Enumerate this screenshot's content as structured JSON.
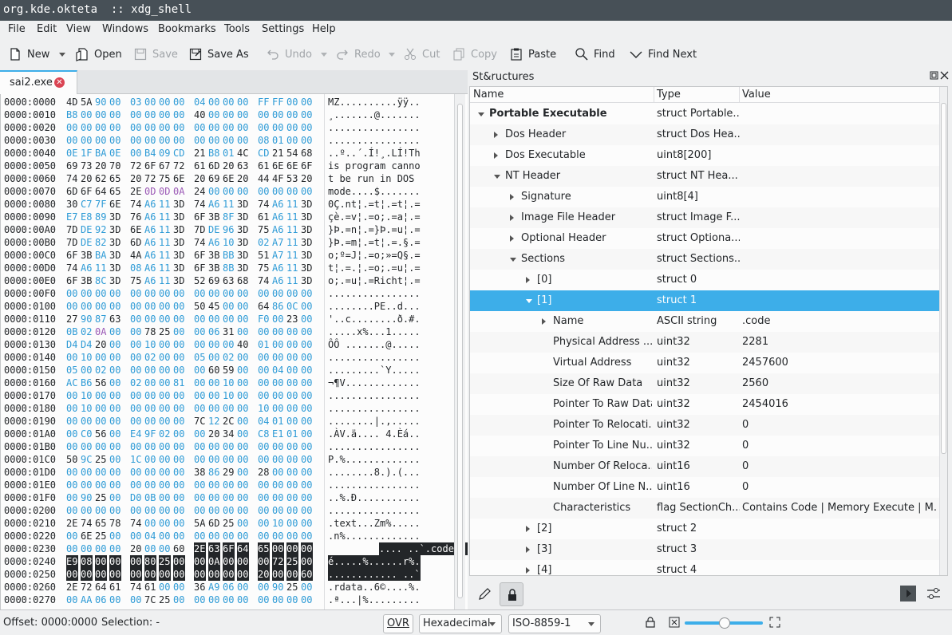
{
  "window": {
    "title": "org.kde.okteta  :: xdg_shell"
  },
  "menu": [
    "File",
    "Edit",
    "View",
    "Windows",
    "Bookmarks",
    "Tools",
    "Settings",
    "Help"
  ],
  "toolbar": {
    "new": "New",
    "open": "Open",
    "save": "Save",
    "save_as": "Save As",
    "undo": "Undo",
    "redo": "Redo",
    "cut": "Cut",
    "copy": "Copy",
    "paste": "Paste",
    "find": "Find",
    "find_next": "Find Next"
  },
  "tab": {
    "label": "sai2.exe"
  },
  "hex_rows": [
    {
      "off": "0000:0000",
      "bytes": [
        "4D",
        "5A",
        "90",
        "00",
        "03",
        "00",
        "00",
        "00",
        "04",
        "00",
        "00",
        "00",
        "FF",
        "FF",
        "00",
        "00"
      ],
      "chars": "MZ..........ÿÿ.."
    },
    {
      "off": "0000:0010",
      "bytes": [
        "B8",
        "00",
        "00",
        "00",
        "00",
        "00",
        "00",
        "00",
        "40",
        "00",
        "00",
        "00",
        "00",
        "00",
        "00",
        "00"
      ],
      "chars": "¸.......@......."
    },
    {
      "off": "0000:0020",
      "bytes": [
        "00",
        "00",
        "00",
        "00",
        "00",
        "00",
        "00",
        "00",
        "00",
        "00",
        "00",
        "00",
        "00",
        "00",
        "00",
        "00"
      ],
      "chars": "................"
    },
    {
      "off": "0000:0030",
      "bytes": [
        "00",
        "00",
        "00",
        "00",
        "00",
        "00",
        "00",
        "00",
        "00",
        "00",
        "00",
        "00",
        "08",
        "01",
        "00",
        "00"
      ],
      "chars": "................"
    },
    {
      "off": "0000:0040",
      "bytes": [
        "0E",
        "1F",
        "BA",
        "0E",
        "00",
        "B4",
        "09",
        "CD",
        "21",
        "B8",
        "01",
        "4C",
        "CD",
        "21",
        "54",
        "68"
      ],
      "chars": "..º..´.Í!¸.LÍ!Th"
    },
    {
      "off": "0000:0050",
      "bytes": [
        "69",
        "73",
        "20",
        "70",
        "72",
        "6F",
        "67",
        "72",
        "61",
        "6D",
        "20",
        "63",
        "61",
        "6E",
        "6E",
        "6F"
      ],
      "chars": "is program canno"
    },
    {
      "off": "0000:0060",
      "bytes": [
        "74",
        "20",
        "62",
        "65",
        "20",
        "72",
        "75",
        "6E",
        "20",
        "69",
        "6E",
        "20",
        "44",
        "4F",
        "53",
        "20"
      ],
      "chars": "t be run in DOS "
    },
    {
      "off": "0000:0070",
      "bytes": [
        "6D",
        "6F",
        "64",
        "65",
        "2E",
        "0D",
        "0D",
        "0A",
        "24",
        "00",
        "00",
        "00",
        "00",
        "00",
        "00",
        "00"
      ],
      "chars": "mode....$......."
    },
    {
      "off": "0000:0080",
      "bytes": [
        "30",
        "C7",
        "7F",
        "6E",
        "74",
        "A6",
        "11",
        "3D",
        "74",
        "A6",
        "11",
        "3D",
        "74",
        "A6",
        "11",
        "3D"
      ],
      "chars": "0Ç.nt¦.=t¦.=t¦.="
    },
    {
      "off": "0000:0090",
      "bytes": [
        "E7",
        "E8",
        "89",
        "3D",
        "76",
        "A6",
        "11",
        "3D",
        "6F",
        "3B",
        "8F",
        "3D",
        "61",
        "A6",
        "11",
        "3D"
      ],
      "chars": "çè.=v¦.=o;.=a¦.="
    },
    {
      "off": "0000:00A0",
      "bytes": [
        "7D",
        "DE",
        "92",
        "3D",
        "6E",
        "A6",
        "11",
        "3D",
        "7D",
        "DE",
        "96",
        "3D",
        "75",
        "A6",
        "11",
        "3D"
      ],
      "chars": "}Þ.=n¦.=}Þ.=u¦.="
    },
    {
      "off": "0000:00B0",
      "bytes": [
        "7D",
        "DE",
        "82",
        "3D",
        "6D",
        "A6",
        "11",
        "3D",
        "74",
        "A6",
        "10",
        "3D",
        "02",
        "A7",
        "11",
        "3D"
      ],
      "chars": "}Þ.=m¦.=t¦.=.§.="
    },
    {
      "off": "0000:00C0",
      "bytes": [
        "6F",
        "3B",
        "BA",
        "3D",
        "4A",
        "A6",
        "11",
        "3D",
        "6F",
        "3B",
        "BB",
        "3D",
        "51",
        "A7",
        "11",
        "3D"
      ],
      "chars": "o;º=J¦.=o;»=Q§.="
    },
    {
      "off": "0000:00D0",
      "bytes": [
        "74",
        "A6",
        "11",
        "3D",
        "08",
        "A6",
        "11",
        "3D",
        "6F",
        "3B",
        "8B",
        "3D",
        "75",
        "A6",
        "11",
        "3D"
      ],
      "chars": "t¦.=.¦.=o;.=u¦.="
    },
    {
      "off": "0000:00E0",
      "bytes": [
        "6F",
        "3B",
        "8C",
        "3D",
        "75",
        "A6",
        "11",
        "3D",
        "52",
        "69",
        "63",
        "68",
        "74",
        "A6",
        "11",
        "3D"
      ],
      "chars": "o;.=u¦.=Richt¦.="
    },
    {
      "off": "0000:00F0",
      "bytes": [
        "00",
        "00",
        "00",
        "00",
        "00",
        "00",
        "00",
        "00",
        "00",
        "00",
        "00",
        "00",
        "00",
        "00",
        "00",
        "00"
      ],
      "chars": "................"
    },
    {
      "off": "0000:0100",
      "bytes": [
        "00",
        "00",
        "00",
        "00",
        "00",
        "00",
        "00",
        "00",
        "50",
        "45",
        "00",
        "00",
        "64",
        "86",
        "0C",
        "00"
      ],
      "chars": "........PE..d..."
    },
    {
      "off": "0000:0110",
      "bytes": [
        "27",
        "90",
        "87",
        "63",
        "00",
        "00",
        "00",
        "00",
        "00",
        "00",
        "00",
        "00",
        "F0",
        "00",
        "23",
        "00"
      ],
      "chars": "'..c........ð.#."
    },
    {
      "off": "0000:0120",
      "bytes": [
        "0B",
        "02",
        "0A",
        "00",
        "00",
        "78",
        "25",
        "00",
        "00",
        "06",
        "31",
        "00",
        "00",
        "00",
        "00",
        "00"
      ],
      "chars": ".....x%...1....."
    },
    {
      "off": "0000:0130",
      "bytes": [
        "D4",
        "D4",
        "20",
        "00",
        "00",
        "10",
        "00",
        "00",
        "00",
        "00",
        "00",
        "40",
        "01",
        "00",
        "00",
        "00"
      ],
      "chars": "ÔÔ .......@....."
    },
    {
      "off": "0000:0140",
      "bytes": [
        "00",
        "10",
        "00",
        "00",
        "00",
        "02",
        "00",
        "00",
        "05",
        "00",
        "02",
        "00",
        "00",
        "00",
        "00",
        "00"
      ],
      "chars": "................"
    },
    {
      "off": "0000:0150",
      "bytes": [
        "05",
        "00",
        "02",
        "00",
        "00",
        "00",
        "00",
        "00",
        "00",
        "60",
        "59",
        "00",
        "00",
        "04",
        "00",
        "00"
      ],
      "chars": ".........`Y....."
    },
    {
      "off": "0000:0160",
      "bytes": [
        "AC",
        "B6",
        "56",
        "00",
        "02",
        "00",
        "00",
        "81",
        "00",
        "00",
        "10",
        "00",
        "00",
        "00",
        "00",
        "00"
      ],
      "chars": "¬¶V............."
    },
    {
      "off": "0000:0170",
      "bytes": [
        "00",
        "10",
        "00",
        "00",
        "00",
        "00",
        "00",
        "00",
        "00",
        "00",
        "10",
        "00",
        "00",
        "00",
        "00",
        "00"
      ],
      "chars": "................"
    },
    {
      "off": "0000:0180",
      "bytes": [
        "00",
        "10",
        "00",
        "00",
        "00",
        "00",
        "00",
        "00",
        "00",
        "00",
        "00",
        "00",
        "10",
        "00",
        "00",
        "00"
      ],
      "chars": "................"
    },
    {
      "off": "0000:0190",
      "bytes": [
        "00",
        "00",
        "00",
        "00",
        "00",
        "00",
        "00",
        "00",
        "7C",
        "12",
        "2C",
        "00",
        "04",
        "01",
        "00",
        "00"
      ],
      "chars": "........|.,....."
    },
    {
      "off": "0000:01A0",
      "bytes": [
        "00",
        "C0",
        "56",
        "00",
        "E4",
        "9F",
        "02",
        "00",
        "00",
        "20",
        "34",
        "00",
        "C8",
        "E1",
        "01",
        "00"
      ],
      "chars": ".ÀV.ä.... 4.Èá.."
    },
    {
      "off": "0000:01B0",
      "bytes": [
        "00",
        "00",
        "00",
        "00",
        "00",
        "00",
        "00",
        "00",
        "00",
        "00",
        "00",
        "00",
        "00",
        "00",
        "00",
        "00"
      ],
      "chars": "................"
    },
    {
      "off": "0000:01C0",
      "bytes": [
        "50",
        "9C",
        "25",
        "00",
        "1C",
        "00",
        "00",
        "00",
        "00",
        "00",
        "00",
        "00",
        "00",
        "00",
        "00",
        "00"
      ],
      "chars": "P.%............."
    },
    {
      "off": "0000:01D0",
      "bytes": [
        "00",
        "00",
        "00",
        "00",
        "00",
        "00",
        "00",
        "00",
        "38",
        "86",
        "29",
        "00",
        "28",
        "00",
        "00",
        "00"
      ],
      "chars": "........8.).(..."
    },
    {
      "off": "0000:01E0",
      "bytes": [
        "00",
        "00",
        "00",
        "00",
        "00",
        "00",
        "00",
        "00",
        "00",
        "00",
        "00",
        "00",
        "00",
        "00",
        "00",
        "00"
      ],
      "chars": "................"
    },
    {
      "off": "0000:01F0",
      "bytes": [
        "00",
        "90",
        "25",
        "00",
        "D0",
        "0B",
        "00",
        "00",
        "00",
        "00",
        "00",
        "00",
        "00",
        "00",
        "00",
        "00"
      ],
      "chars": "..%.Ð..........."
    },
    {
      "off": "0000:0200",
      "bytes": [
        "00",
        "00",
        "00",
        "00",
        "00",
        "00",
        "00",
        "00",
        "00",
        "00",
        "00",
        "00",
        "00",
        "00",
        "00",
        "00"
      ],
      "chars": "................"
    },
    {
      "off": "0000:0210",
      "bytes": [
        "2E",
        "74",
        "65",
        "78",
        "74",
        "00",
        "00",
        "00",
        "5A",
        "6D",
        "25",
        "00",
        "00",
        "10",
        "00",
        "00"
      ],
      "chars": ".text...Zm%....."
    },
    {
      "off": "0000:0220",
      "bytes": [
        "00",
        "6E",
        "25",
        "00",
        "00",
        "04",
        "00",
        "00",
        "00",
        "00",
        "00",
        "00",
        "00",
        "00",
        "00",
        "00"
      ],
      "chars": ".n%............."
    },
    {
      "off": "0000:0230",
      "bytes": [
        "00",
        "00",
        "00",
        "00",
        "20",
        "00",
        "00",
        "60",
        "2E",
        "63",
        "6F",
        "64",
        "65",
        "00",
        "00",
        "00"
      ],
      "chars": ".... ..`.code..."
    },
    {
      "off": "0000:0240",
      "bytes": [
        "E9",
        "08",
        "00",
        "00",
        "00",
        "80",
        "25",
        "00",
        "00",
        "0A",
        "00",
        "00",
        "00",
        "72",
        "25",
        "00"
      ],
      "chars": "é.....%......r%."
    },
    {
      "off": "0000:0250",
      "bytes": [
        "00",
        "00",
        "00",
        "00",
        "00",
        "00",
        "00",
        "00",
        "00",
        "00",
        "00",
        "00",
        "20",
        "00",
        "00",
        "60"
      ],
      "chars": "............ ..`"
    },
    {
      "off": "0000:0260",
      "bytes": [
        "2E",
        "72",
        "64",
        "61",
        "74",
        "61",
        "00",
        "00",
        "36",
        "A9",
        "06",
        "00",
        "00",
        "90",
        "25",
        "00"
      ],
      "chars": ".rdata..6©....%."
    },
    {
      "off": "0000:0270",
      "bytes": [
        "00",
        "AA",
        "06",
        "00",
        "00",
        "7C",
        "25",
        "00",
        "00",
        "00",
        "00",
        "00",
        "00",
        "00",
        "00",
        "00"
      ],
      "chars": ".ª...|%........."
    }
  ],
  "structures": {
    "title": "St&ructures",
    "columns": [
      "Name",
      "Type",
      "Value"
    ],
    "rows": [
      {
        "name": "Portable Executable",
        "type": "struct Portable...",
        "value": "",
        "depth": 0,
        "exp": "down",
        "bold": true
      },
      {
        "name": "Dos Header",
        "type": "struct Dos Hea...",
        "value": "",
        "depth": 1,
        "exp": "right"
      },
      {
        "name": "Dos Executable",
        "type": "uint8[200]",
        "value": "",
        "depth": 1,
        "exp": "right"
      },
      {
        "name": "NT Header",
        "type": "struct NT Hea...",
        "value": "",
        "depth": 1,
        "exp": "down"
      },
      {
        "name": "Signature",
        "type": "uint8[4]",
        "value": "",
        "depth": 2,
        "exp": "right"
      },
      {
        "name": "Image File Header",
        "type": "struct Image F...",
        "value": "",
        "depth": 2,
        "exp": "right"
      },
      {
        "name": "Optional Header",
        "type": "struct Optiona...",
        "value": "",
        "depth": 2,
        "exp": "right"
      },
      {
        "name": "Sections",
        "type": "struct Sections...",
        "value": "",
        "depth": 2,
        "exp": "down"
      },
      {
        "name": "[0]",
        "type": "struct 0",
        "value": "",
        "depth": 3,
        "exp": "right"
      },
      {
        "name": "[1]",
        "type": "struct 1",
        "value": "",
        "depth": 3,
        "exp": "down",
        "selected": true
      },
      {
        "name": "Name",
        "type": "ASCII string",
        "value": ".code",
        "depth": 4,
        "exp": "right"
      },
      {
        "name": "Physical Address ...",
        "type": "uint32",
        "value": "2281",
        "depth": 4
      },
      {
        "name": "Virtual Address",
        "type": "uint32",
        "value": "2457600",
        "depth": 4
      },
      {
        "name": "Size Of Raw Data",
        "type": "uint32",
        "value": "2560",
        "depth": 4
      },
      {
        "name": "Pointer To Raw Data",
        "type": "uint32",
        "value": "2454016",
        "depth": 4
      },
      {
        "name": "Pointer To Relocati...",
        "type": "uint32",
        "value": "0",
        "depth": 4
      },
      {
        "name": "Pointer To Line Nu...",
        "type": "uint32",
        "value": "0",
        "depth": 4
      },
      {
        "name": "Number Of Reloca...",
        "type": "uint16",
        "value": "0",
        "depth": 4
      },
      {
        "name": "Number Of Line N...",
        "type": "uint16",
        "value": "0",
        "depth": 4
      },
      {
        "name": "Characteristics",
        "type": "flag SectionCh...",
        "value": "Contains Code | Memory Execute | M...",
        "depth": 4
      },
      {
        "name": "[2]",
        "type": "struct 2",
        "value": "",
        "depth": 3,
        "exp": "right"
      },
      {
        "name": "[3]",
        "type": "struct 3",
        "value": "",
        "depth": 3,
        "exp": "right"
      },
      {
        "name": "[4]",
        "type": "struct 4",
        "value": "",
        "depth": 3,
        "exp": "right"
      }
    ]
  },
  "status": {
    "offset": "Offset: 0000:0000",
    "selection": "Selection: -",
    "ovr": "OVR",
    "encoding_value": "Hexadecimal",
    "charset": "ISO-8859-1"
  },
  "colors": {
    "accent": "#3daee9",
    "titlebar": "#475057",
    "byte_zero": "#2e9bd6",
    "byte_ctrl": "#9b59b6"
  }
}
